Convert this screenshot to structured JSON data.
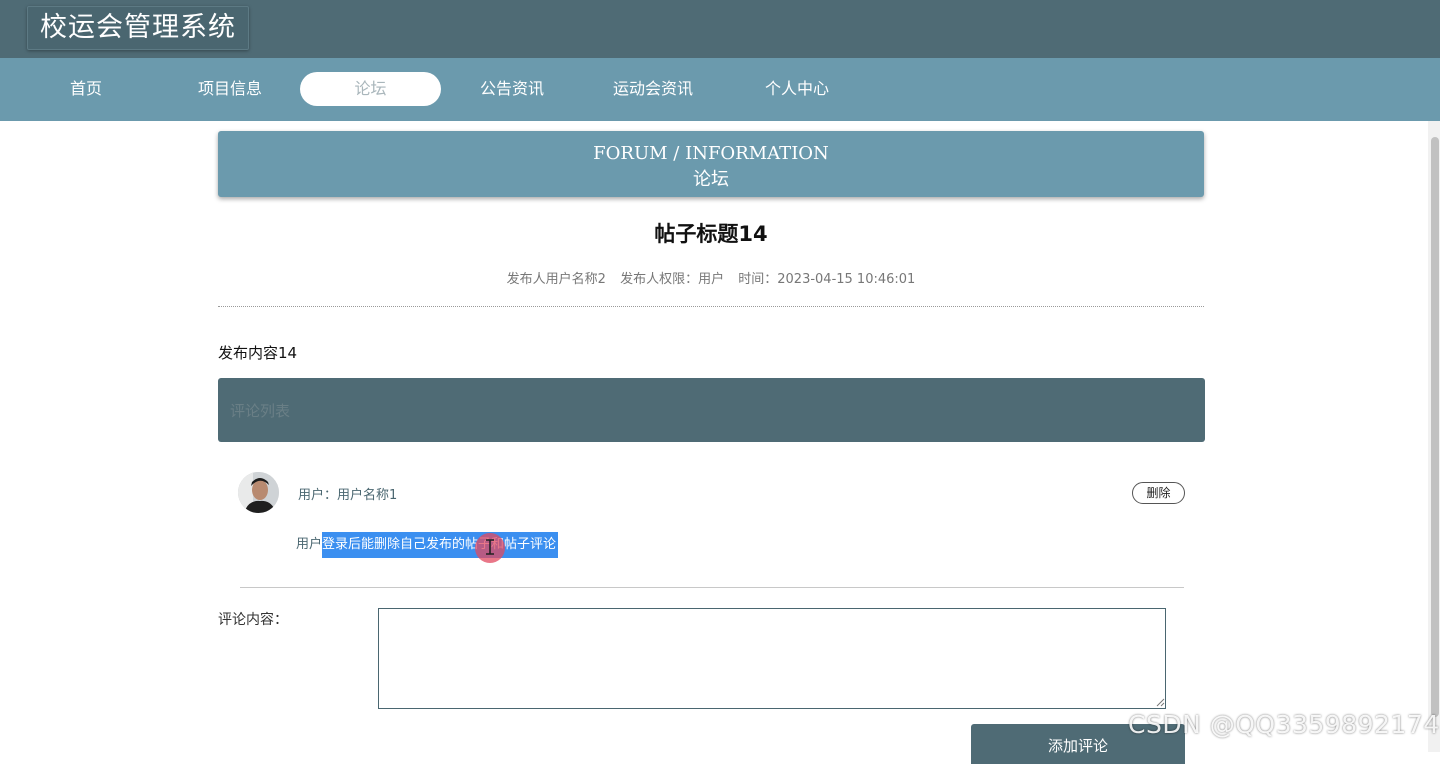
{
  "app": {
    "title": "校运会管理系统"
  },
  "nav": {
    "items": [
      {
        "label": "首页"
      },
      {
        "label": "项目信息"
      },
      {
        "label": "论坛"
      },
      {
        "label": "公告资讯"
      },
      {
        "label": "运动会资讯"
      },
      {
        "label": "个人中心"
      }
    ],
    "active": "论坛"
  },
  "banner": {
    "en": "FORUM / INFORMATION",
    "cn": "论坛"
  },
  "post": {
    "title": "帖子标题14",
    "author": "发布人用户名称2",
    "role": "发布人权限：用户",
    "time": "时间：2023-04-15 10:46:01",
    "content": "发布内容14"
  },
  "comments_section": {
    "header_label": "评论列表"
  },
  "comments": [
    {
      "user": "用户：用户名称1",
      "delete_label": "删除",
      "text_prefix": "用户",
      "text_selected": "登录后能删除自己发布的帖子和帖子评论"
    }
  ],
  "form": {
    "label": "评论内容：",
    "value": "",
    "placeholder": "",
    "submit_label": "添加评论"
  },
  "watermark": "CSDN @QQ3359892174",
  "icons": {
    "text_cursor": "text-cursor-icon",
    "avatar": "user-avatar-photo",
    "resize": "resize-grip-icon"
  },
  "colors": {
    "topbar": "#4f6b75",
    "navbar": "#6b9aad",
    "selection": "#3b8ff0",
    "cursor_highlight": "#e24a60"
  }
}
